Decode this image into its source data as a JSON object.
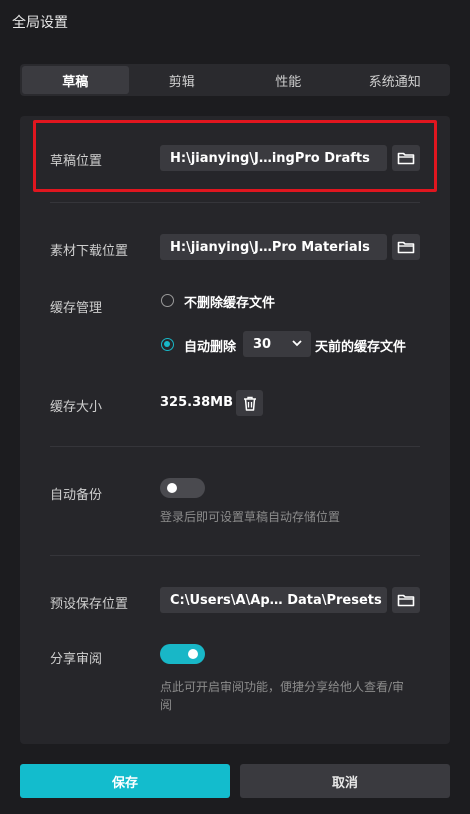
{
  "window": {
    "title": "全局设置"
  },
  "tabs": [
    {
      "label": "草稿",
      "active": true
    },
    {
      "label": "剪辑",
      "active": false
    },
    {
      "label": "性能",
      "active": false
    },
    {
      "label": "系统通知",
      "active": false
    }
  ],
  "draft": {
    "label": "草稿位置",
    "path": "H:\\jianying\\J…ingPro Drafts"
  },
  "material": {
    "label": "素材下载位置",
    "path": "H:\\jianying\\J…Pro Materials"
  },
  "cache": {
    "label": "缓存管理",
    "option_keep": "不删除缓存文件",
    "option_auto_prefix": "自动删除",
    "days": "30",
    "option_auto_suffix": "天前的缓存文件",
    "selected": "auto"
  },
  "cache_size": {
    "label": "缓存大小",
    "value": "325.38MB"
  },
  "backup": {
    "label": "自动备份",
    "enabled": false,
    "hint": "登录后即可设置草稿自动存储位置"
  },
  "preset": {
    "label": "预设保存位置",
    "path": "C:\\Users\\A\\Ap… Data\\Presets"
  },
  "share": {
    "label": "分享审阅",
    "enabled": true,
    "hint_line1": "点此可开启审阅功能，便捷分享给他人查看/审",
    "hint_line2": "阅"
  },
  "footer": {
    "save_label": "保存",
    "cancel_label": "取消"
  },
  "colors": {
    "accent": "#13bccd",
    "highlight": "#e0161f",
    "background": "#1c1c1f"
  }
}
